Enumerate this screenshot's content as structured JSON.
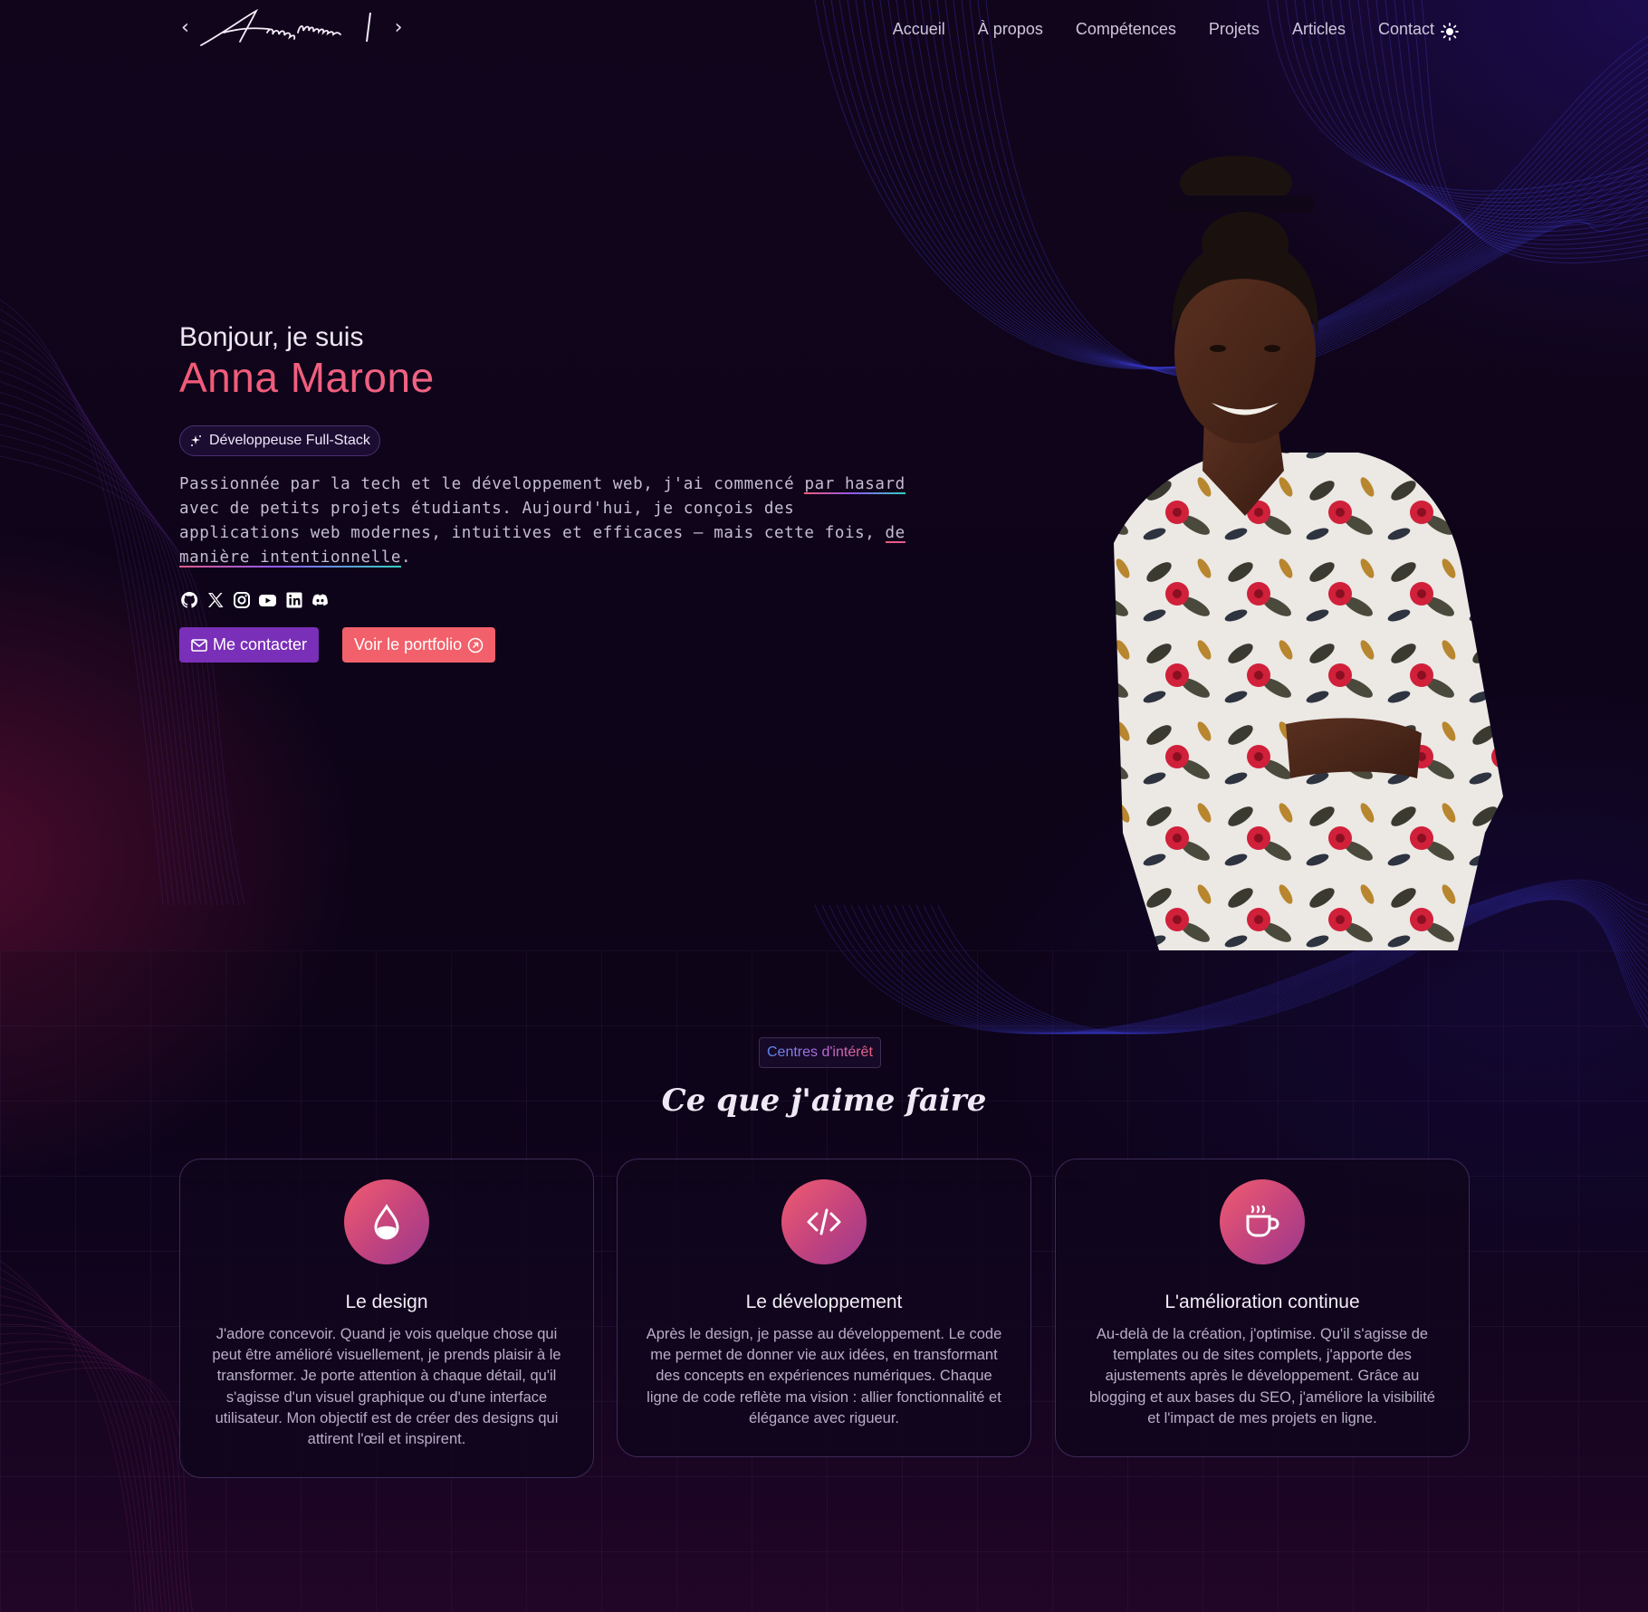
{
  "nav": {
    "logo_text": "Anna marone",
    "links": [
      {
        "label": "Accueil"
      },
      {
        "label": "À propos"
      },
      {
        "label": "Compétences"
      },
      {
        "label": "Projets"
      },
      {
        "label": "Articles"
      },
      {
        "label": "Contact"
      }
    ],
    "theme_icon": "sun-icon"
  },
  "hero": {
    "greeting": "Bonjour, je suis",
    "name": "Anna Marone",
    "role": "Développeuse Full-Stack",
    "bio": {
      "part1": "Passionnée par la tech et le développement web, j'ai commencé ",
      "link1": "par hasard",
      "part2": " avec de petits projets étudiants. Aujourd'hui, je conçois des applications web modernes, intuitives et efficaces — mais cette fois, ",
      "link2": "de manière intentionnelle",
      "part3": "."
    },
    "socials": [
      "github-icon",
      "x-icon",
      "instagram-icon",
      "youtube-icon",
      "linkedin-icon",
      "discord-icon"
    ],
    "contact_button": "Me contacter",
    "portfolio_button": "Voir le portfolio"
  },
  "interests": {
    "badge": "Centres d'intérêt",
    "title": "Ce que j'aime faire",
    "cards": [
      {
        "icon": "droplet-icon",
        "title": "Le design",
        "text": "J'adore concevoir. Quand je vois quelque chose qui peut être amélioré visuellement, je prends plaisir à le transformer. Je porte attention à chaque détail, qu'il s'agisse d'un visuel graphique ou d'une interface utilisateur. Mon objectif est de créer des designs qui attirent l'œil et inspirent."
      },
      {
        "icon": "code-icon",
        "title": "Le développement",
        "text": "Après le design, je passe au développement. Le code me permet de donner vie aux idées, en transformant des concepts en expériences numériques. Chaque ligne de code reflète ma vision : allier fonctionnalité et élégance avec rigueur."
      },
      {
        "icon": "coffee-cup-icon",
        "title": "L'amélioration continue",
        "text": "Au-delà de la création, j'optimise. Qu'il s'agisse de templates ou de sites complets, j'apporte des ajustements après le développement. Grâce au blogging et aux bases du SEO, j'améliore la visibilité et l'impact de mes projets en ligne."
      }
    ]
  },
  "colors": {
    "accent_pink": "#f05a78",
    "accent_purple": "#7a2fb8",
    "accent_coral": "#f2616b",
    "background": "#0c0414"
  }
}
